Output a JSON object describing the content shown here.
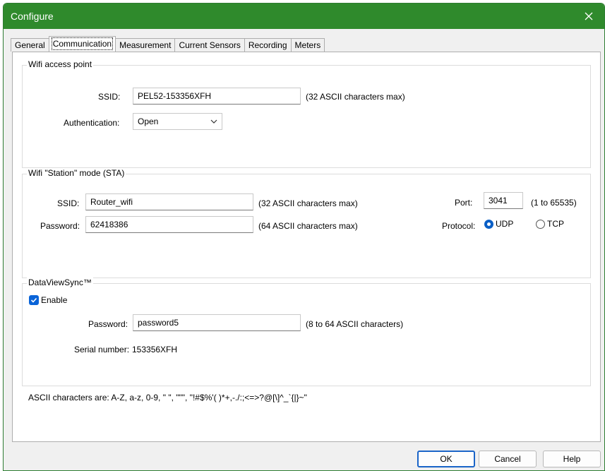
{
  "window": {
    "title": "Configure"
  },
  "tabs": [
    {
      "label": "General"
    },
    {
      "label": "Communication"
    },
    {
      "label": "Measurement"
    },
    {
      "label": "Current Sensors"
    },
    {
      "label": "Recording"
    },
    {
      "label": "Meters"
    }
  ],
  "wifi_ap": {
    "legend": "Wifi access point",
    "ssid_label": "SSID:",
    "ssid_value": "PEL52-153356XFH",
    "ssid_hint": "(32 ASCII characters max)",
    "auth_label": "Authentication:",
    "auth_value": "Open"
  },
  "sta": {
    "legend": "Wifi \"Station\" mode (STA)",
    "ssid_label": "SSID:",
    "ssid_value": "Router_wifi",
    "ssid_hint": "(32 ASCII characters max)",
    "password_label": "Password:",
    "password_value": "62418386",
    "password_hint": "(64 ASCII characters max)",
    "port_label": "Port:",
    "port_value": "3041",
    "port_hint": "(1 to 65535)",
    "protocol_label": "Protocol:",
    "protocol_udp": "UDP",
    "protocol_tcp": "TCP",
    "protocol_selected": "UDP"
  },
  "dvs": {
    "legend": "DataViewSync™",
    "enable_label": "Enable",
    "enable_checked": true,
    "password_label": "Password:",
    "password_value": "password5",
    "password_hint": "(8 to 64 ASCII characters)",
    "serial_label": "Serial number:",
    "serial_value": "153356XFH"
  },
  "ascii_note": "ASCII characters are: A-Z, a-z, 0-9,  \" \", \"\"\", \"!#$%'( )*+,-./:;<=>?@[\\]^_`{|}~\"",
  "buttons": {
    "ok": "OK",
    "cancel": "Cancel",
    "help": "Help"
  }
}
